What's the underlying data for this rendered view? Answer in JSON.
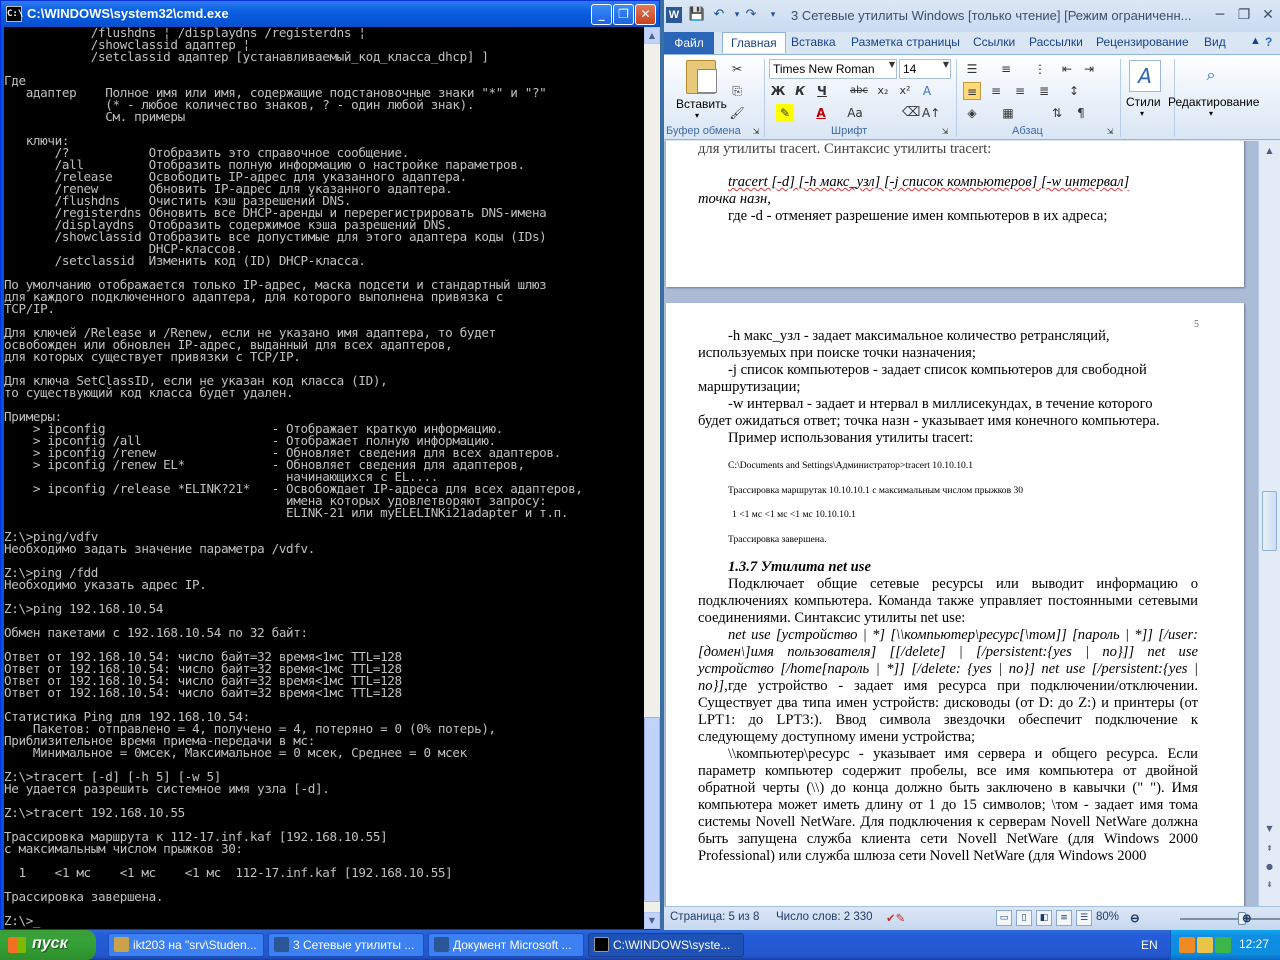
{
  "cmd": {
    "title": "C:\\WINDOWS\\system32\\cmd.exe",
    "icon_name": "cmd-icon",
    "lines": [
      "            /flushdns ¦ /displaydns /registerdns ¦",
      "            /showclassid адаптер ¦",
      "            /setclassid адаптер [устанавливаемый_код_класса_dhcp] ]",
      "",
      "Где",
      "   адаптер    Полное имя или имя, содержащие подстановочные знаки \"*\" и \"?\"",
      "              (* - любое количество знаков, ? - один любой знак).",
      "              См. примеры",
      "",
      "   ключи:",
      "       /?           Отобразить это справочное сообщение.",
      "       /all         Отобразить полную информацию о настройке параметров.",
      "       /release     Освободить IP-адрес для указанного адаптера.",
      "       /renew       Обновить IP-адрес для указанного адаптера.",
      "       /flushdns    Очистить кэш разрешений DNS.",
      "       /registerdns Обновить все DHCP-аренды и перерегистрировать DNS-имена",
      "       /displaydns  Отобразить содержимое кэша разрешений DNS.",
      "       /showclassid Отобразить все допустимые для этого адаптера коды (IDs)",
      "                    DHCP-классов.",
      "       /setclassid  Изменить код (ID) DHCP-класса.",
      "",
      "По умолчанию отображается только IP-адрес, маска подсети и стандартный шлюз",
      "для каждого подключенного адаптера, для которого выполнена привязка с",
      "TCP/IP.",
      "",
      "Для ключей /Release и /Renew, если не указано имя адаптера, то будет",
      "освобожден или обновлен IP-адрес, выданный для всех адаптеров,",
      "для которых существует привязки с TCP/IP.",
      "",
      "Для ключа SetClassID, если не указан код класса (ID),",
      "то существующий код класса будет удален.",
      "",
      "Примеры:",
      "    > ipconfig                       - Отображает краткую информацию.",
      "    > ipconfig /all                  - Отображает полную информацию.",
      "    > ipconfig /renew                - Обновляет сведения для всех адаптеров.",
      "    > ipconfig /renew EL*            - Обновляет сведения для адаптеров,",
      "                                       начинающихся с EL....",
      "    > ipconfig /release *ELINK?21*   - Освобождает IP-адреса для всех адаптеров,",
      "                                       имена которых удовлетворяют запросу:",
      "                                       ELINK-21 или myELELINKi21adapter и т.п.",
      "",
      "Z:\\>ping/vdfv",
      "Необходимо задать значение параметра /vdfv.",
      "",
      "Z:\\>ping /fdd",
      "Необходимо указать адрес IP.",
      "",
      "Z:\\>ping 192.168.10.54",
      "",
      "Обмен пакетами с 192.168.10.54 по 32 байт:",
      "",
      "Ответ от 192.168.10.54: число байт=32 время<1мс TTL=128",
      "Ответ от 192.168.10.54: число байт=32 время<1мс TTL=128",
      "Ответ от 192.168.10.54: число байт=32 время<1мс TTL=128",
      "Ответ от 192.168.10.54: число байт=32 время<1мс TTL=128",
      "",
      "Статистика Ping для 192.168.10.54:",
      "    Пакетов: отправлено = 4, получено = 4, потеряно = 0 (0% потерь),",
      "Приблизительное время приема-передачи в мс:",
      "    Минимальное = 0мсек, Максимальное = 0 мсек, Среднее = 0 мсек",
      "",
      "Z:\\>tracert [-d] [-h 5] [-w 5]",
      "Не удается разрешить системное имя узла [-d].",
      "",
      "Z:\\>tracert 192.168.10.55",
      "",
      "Трассировка маршрута к 112-17.inf.kaf [192.168.10.55]",
      "с максимальным числом прыжков 30:",
      "",
      "  1    <1 мс    <1 мс    <1 мс  112-17.inf.kaf [192.168.10.55]",
      "",
      "Трассировка завершена.",
      "",
      "Z:\\>_"
    ]
  },
  "word": {
    "title": "3 Сетевые утилиты Windows [только чтение] [Режим ограниченн...",
    "file_tab": "Файл",
    "tabs": [
      "Главная",
      "Вставка",
      "Разметка страницы",
      "Ссылки",
      "Рассылки",
      "Рецензирование",
      "Вид"
    ],
    "ribbon": {
      "paste_label": "Вставить",
      "font_name": "Times New Roman",
      "font_size": "14",
      "styles_label": "Стили",
      "editing_label": "Редактирование",
      "groups": [
        "Буфер обмена",
        "Шрифт",
        "Абзац"
      ]
    },
    "page1": {
      "top_line": "для утилиты tracert. Синтаксис утилиты tracert:",
      "syntax": "tracert [-d] [-h макс_узл] [-j список компьютеров] [-w интервал]",
      "syntax2": "точка назн,",
      "desc": "где -d - отменяет разрешение имен компьютеров в их адреса;"
    },
    "page2": {
      "page_number": "5",
      "l1": "-h макс_узл - задает максимальное количество ретрансляций,",
      "l2": "используемых при поиске точки назначения;",
      "l3a": "-j список компьютеров - задает список компьютеров для свободной",
      "l4": "маршрутизации;",
      "l5": "-w интервал - задает и нтервал в миллисекундах, в течение которого",
      "l6": "будет ожидаться ответ; точка назн - указывает имя конечного компьютера.",
      "l7": "Пример использования утилиты tracert:",
      "s1": "C:\\Documents and Settings\\Администратор>tracert 10.10.10.1",
      "s2": "Трассировка маршрутак 10.10.10.1 с максимальным числом прыжков 30",
      "s3": "1     <1 мс    <1 мс    <1 мс  10.10.10.1",
      "s4": "Трассировка завершена.",
      "heading": "1.3.7 Утилита net use",
      "p1": "Подключает общие сетевые ресурсы или выводит информацию о подключениях компьютера. Команда также управляет постоянными сетевыми соединениями. Синтаксис утилиты net use:",
      "p2": "net use [устройство | *] [\\\\компьютер\\ресурс[\\том]] [пароль | *]] [/user:[домен\\]имя пользователя] [[/delete] | [/persistent:{yes | no}]] net use устройство [/home[пароль | *]] [/delete: {yes | no}] net use [/persistent:{yes | no}],",
      "p3": "где устройство - задает имя ресурса при подключении/отключении. Существует два типа имен устройств: дисководы (от D: до Z:) и принтеры (от LPT1: до LPT3:). Ввод символа звездочки обеспечит подключение к следующему доступному имени устройства;",
      "p4": "\\\\компьютер\\ресурс - указывает имя сервера и общего ресурса. Если параметр компьютер содержит пробелы, все имя компьютера от двойной обратной черты (\\\\) до конца должно быть заключено в кавычки (\" \"). Имя компьютера может иметь длину от 1 до 15 символов; \\том - задает имя тома системы Novell NetWare. Для подключения к серверам Novell NetWare должна быть запущена служба клиента сети Novell NetWare (для Windows 2000 Professional) или служба шлюза сети Novell NetWare (для Windows 2000"
    },
    "status": {
      "page": "Страница: 5 из 8",
      "words": "Число слов: 2 330",
      "zoom": "80%",
      "zoom_level": 0.62
    }
  },
  "taskbar": {
    "start_label": "пуск",
    "tasks": [
      {
        "label": "ikt203 на \"srv\\Studen...",
        "color": "#c9a24b"
      },
      {
        "label": "3 Сетевые утилиты ...",
        "color": "#2b5797"
      },
      {
        "label": "Документ Microsoft ...",
        "color": "#2b5797"
      },
      {
        "label": "C:\\WINDOWS\\syste...",
        "color": "#000000"
      }
    ],
    "lang": "EN",
    "clock": "12:27"
  }
}
